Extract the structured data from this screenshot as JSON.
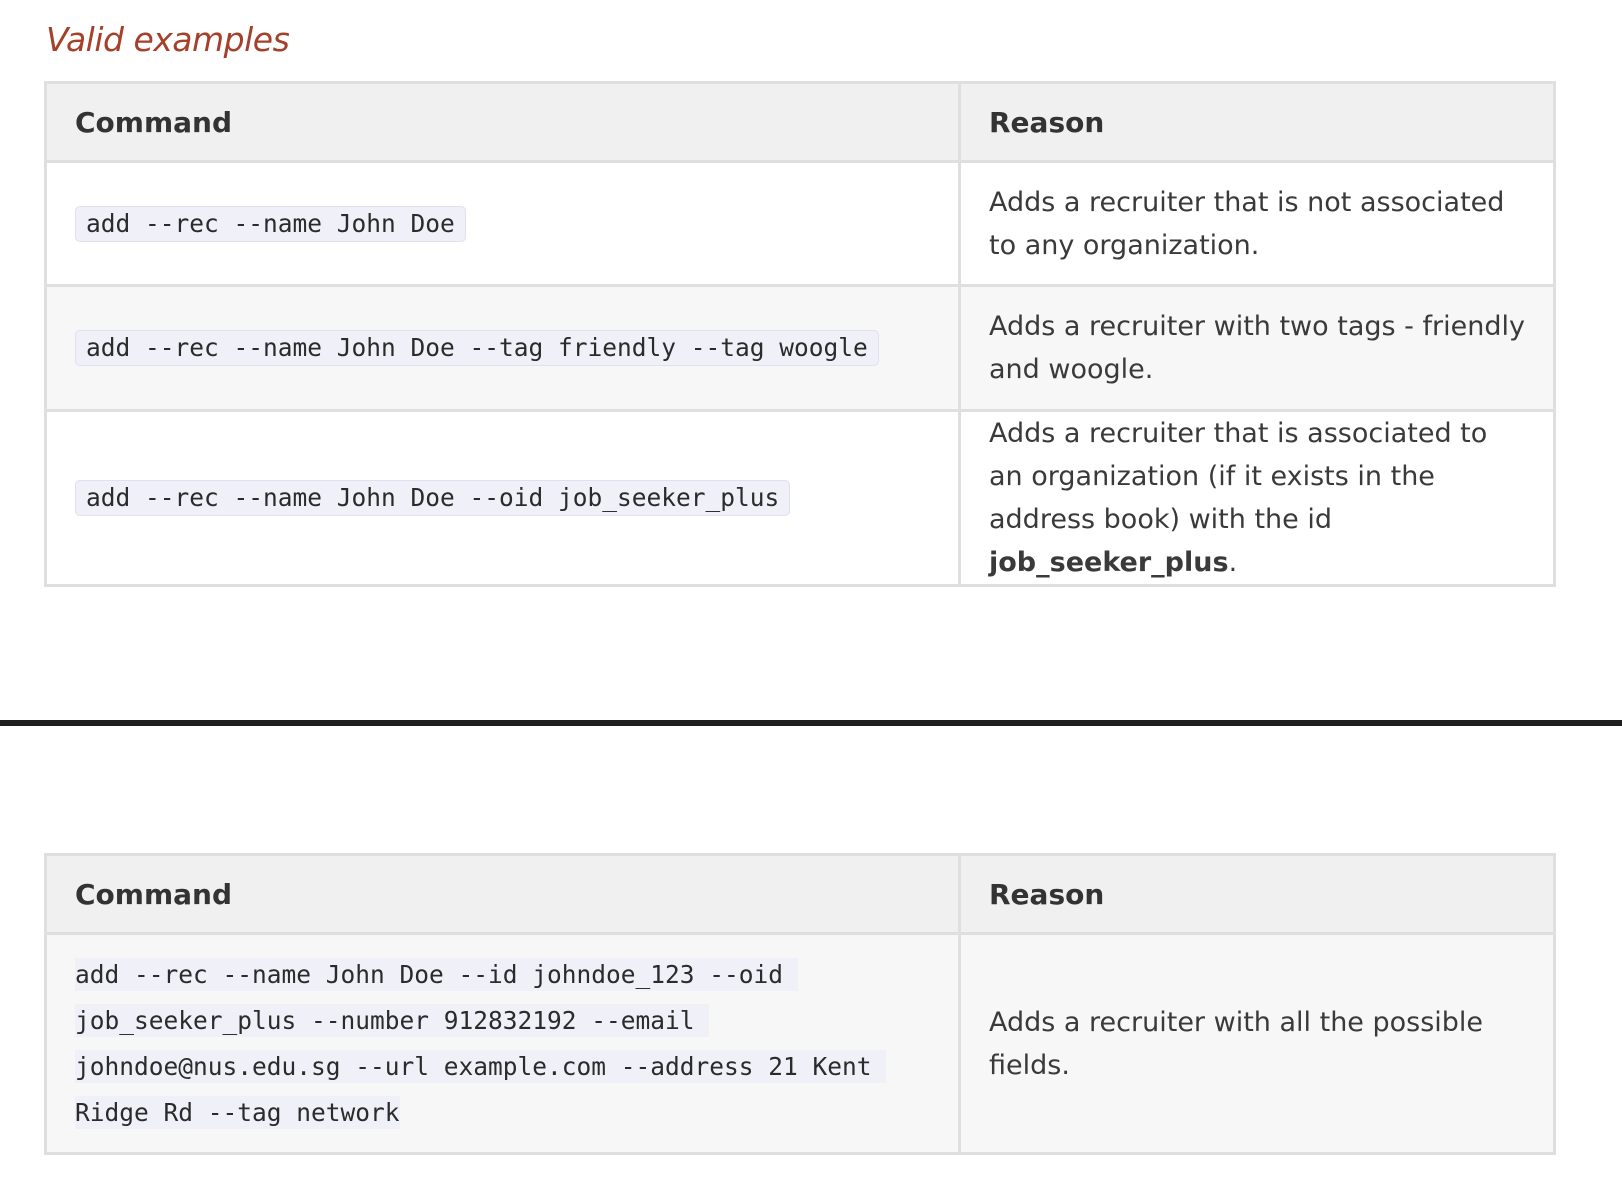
{
  "section": {
    "heading": "Valid examples"
  },
  "table1": {
    "headers": [
      "Command",
      "Reason"
    ],
    "rows": [
      {
        "command": "add --rec --name John Doe",
        "reason": "Adds a recruiter that is not associated to any organization."
      },
      {
        "command": "add --rec --name John Doe --tag friendly --tag woogle",
        "reason": "Adds a recruiter with two tags - friendly and woogle."
      },
      {
        "command": "add --rec --name John Doe --oid job_seeker_plus",
        "reason_prefix": "Adds a recruiter that is associated to an organization (if it exists in the address book) with the id ",
        "reason_bold": "job_seeker_plus",
        "reason_suffix": "."
      }
    ]
  },
  "table2": {
    "headers": [
      "Command",
      "Reason"
    ],
    "rows": [
      {
        "command": "add --rec --name John Doe --id johndoe_123 --oid job_seeker_plus --number 912832192 --email johndoe@nus.edu.sg --url example.com --address 21 Kent Ridge Rd --tag network",
        "reason": "Adds a recruiter with all the possible fields."
      }
    ]
  }
}
